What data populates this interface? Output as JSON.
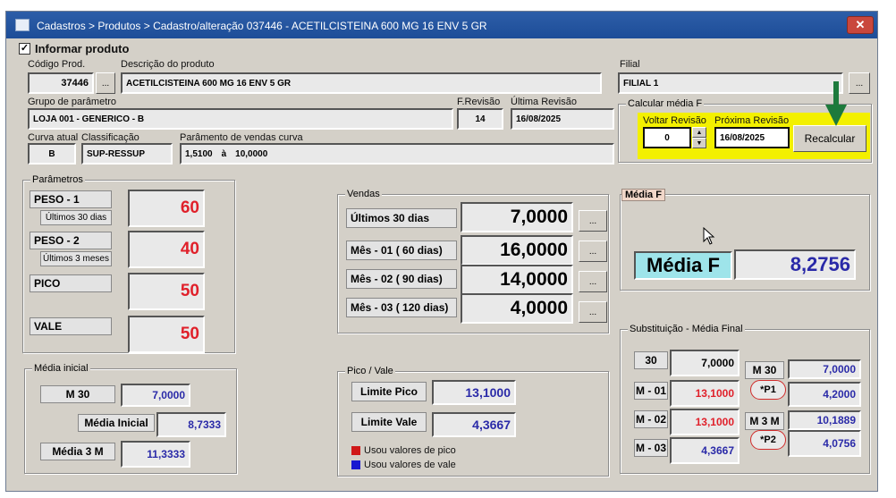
{
  "window": {
    "title": "Cadastros > Produtos > Cadastro/alteração 037446 - ACETILCISTEINA 600 MG 16 ENV 5 GR",
    "close_glyph": "✕"
  },
  "informar_produto": {
    "label": "Informar produto",
    "checked": true
  },
  "produto": {
    "codigo_label": "Código Prod.",
    "codigo": "37446",
    "descricao_label": "Descrição do produto",
    "descricao": "ACETILCISTEINA 600 MG 16 ENV 5 GR",
    "filial_label": "Filial",
    "filial": "FILIAL 1",
    "lookup_glyph": "..."
  },
  "grupo": {
    "label": "Grupo de parâmetro",
    "value": "LOJA 001 - GENERICO - B",
    "frevisao_label": "F.Revisão",
    "frevisao": "14",
    "ultima_label": "Última Revisão",
    "ultima": "16/08/2025"
  },
  "curva": {
    "curva_label": "Curva atual",
    "curva": "B",
    "class_label": "Classificação",
    "classificacao": "SUP-RESSUP",
    "param_label": "Parâmento de vendas curva",
    "param_from": "1,5100",
    "param_sep": "à",
    "param_to": "10,0000"
  },
  "calcular": {
    "title": "Calcular média F",
    "voltar_label": "Voltar Revisão",
    "voltar": "0",
    "proxima_label": "Próxima Revisão",
    "proxima": "16/08/2025",
    "recalcular": "Recalcular"
  },
  "parametros": {
    "title": "Parâmetros",
    "peso1": "PESO - 1",
    "peso1_sub": "Últimos 30 dias",
    "peso1_val": "60",
    "peso2": "PESO - 2",
    "peso2_sub": "Últimos 3 meses",
    "peso2_val": "40",
    "pico": "PICO",
    "pico_val": "50",
    "vale": "VALE",
    "vale_val": "50"
  },
  "vendas": {
    "title": "Vendas",
    "rows": [
      {
        "label": "Últimos 30 dias",
        "value": "7,0000"
      },
      {
        "label": "Mês - 01 ( 60 dias)",
        "value": "16,0000"
      },
      {
        "label": "Mês - 02 ( 90 dias)",
        "value": "14,0000"
      },
      {
        "label": "Mês - 03 ( 120 dias)",
        "value": "4,0000"
      }
    ]
  },
  "media_f": {
    "title": "Média F",
    "label": "Média F",
    "value": "8,2756"
  },
  "media_inicial": {
    "title": "Média inicial",
    "m30_label": "M 30",
    "m30": "7,0000",
    "inicial_label": "Média Inicial",
    "inicial": "8,7333",
    "m3_label": "Média 3 M",
    "m3": "11,3333"
  },
  "pico_vale": {
    "title": "Pico / Vale",
    "limite_pico_label": "Limite Pico",
    "limite_pico": "13,1000",
    "limite_vale_label": "Limite Vale",
    "limite_vale": "4,3667",
    "legend_pico": "Usou valores de pico",
    "legend_vale": "Usou valores de vale",
    "color_pico": "#d01818",
    "color_vale": "#1818d0"
  },
  "substituicao": {
    "title": "Substituição - Média Final",
    "r30_label": "30",
    "r30": "7,0000",
    "m01_label": "M - 01",
    "m01": "13,1000",
    "m02_label": "M - 02",
    "m02": "13,1000",
    "m03_label": "M - 03",
    "m03": "4,3667",
    "rm30_label": "M 30",
    "rm30": "7,0000",
    "p1_label": "*P1",
    "p1": "4,2000",
    "rm3m_label": "M 3 M",
    "rm3m": "10,1889",
    "p2_label": "*P2",
    "p2": "4,0756"
  }
}
